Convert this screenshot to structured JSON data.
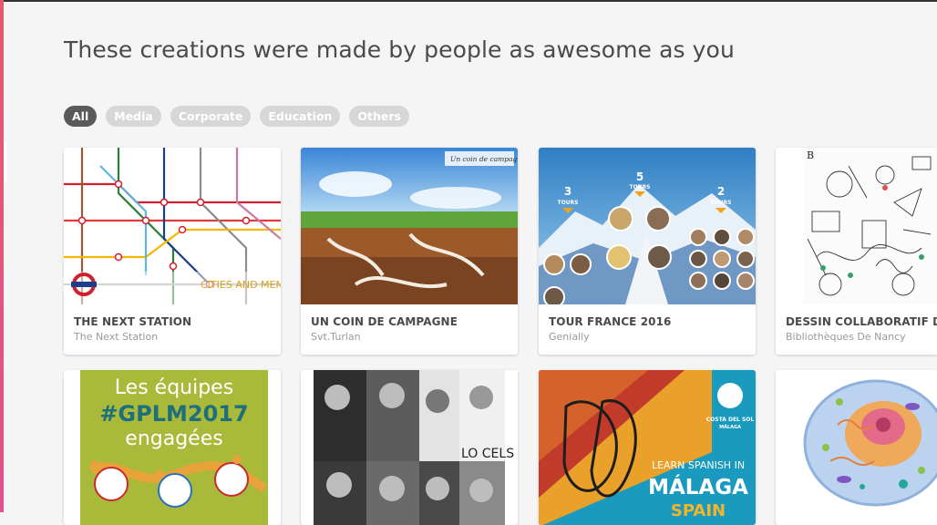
{
  "heading": "These creations were made by people as awesome as you",
  "filters": [
    {
      "label": "All",
      "active": true
    },
    {
      "label": "Media",
      "active": false
    },
    {
      "label": "Corporate",
      "active": false
    },
    {
      "label": "Education",
      "active": false
    },
    {
      "label": "Others",
      "active": false
    }
  ],
  "cards": [
    {
      "title": "THE NEXT STATION",
      "author": "The Next Station",
      "thumb_caption": "CITIES AND MEMORY",
      "thumb_kind": "subway-map"
    },
    {
      "title": "UN COIN DE CAMPAGNE",
      "author": "Svt.Turlan",
      "thumb_caption": "Un coin de campagne",
      "thumb_kind": "countryside-soil"
    },
    {
      "title": "TOUR FRANCE 2016",
      "author": "Genially",
      "thumb_kind": "mountain-riders",
      "stat_labels": [
        "3",
        "5",
        "2"
      ],
      "stat_unit": "TOURS"
    },
    {
      "title": "DESSIN COLLABORATIF DE",
      "author": "Bibliothèques De Nancy",
      "thumb_kind": "line-drawing"
    },
    {
      "title": "",
      "author": "",
      "thumb_kind": "poster-teams",
      "thumb_text": [
        "Les équipes",
        "#GPLM2017",
        "engagées"
      ]
    },
    {
      "title": "",
      "author": "",
      "thumb_kind": "photo-collage",
      "thumb_text": [
        "LO CELS"
      ]
    },
    {
      "title": "",
      "author": "",
      "thumb_kind": "spain-fish",
      "thumb_text": [
        "COSTA DEL SOL",
        "MÁLAGA",
        "LEARN SPANISH IN",
        "MÁLAGA",
        "SPAIN"
      ]
    },
    {
      "title": "",
      "author": "",
      "thumb_kind": "cell-diagram"
    }
  ],
  "colors": {
    "accent_bar": "#e5576d",
    "active_chip": "#5a5a5a",
    "inactive_chip": "#d7d7d7"
  }
}
